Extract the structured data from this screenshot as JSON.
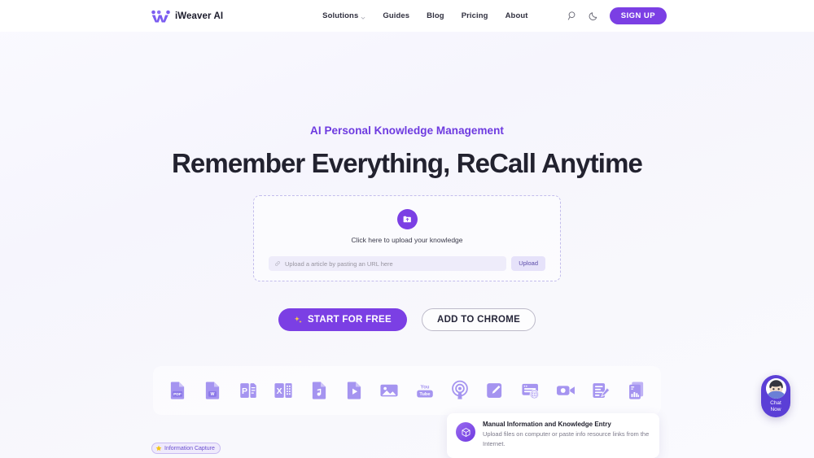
{
  "header": {
    "brand": {
      "name": "iWeaver AI",
      "logo_icon": "weaver-w-logo-icon"
    },
    "nav": [
      {
        "label": "Solutions",
        "has_dropdown": true
      },
      {
        "label": "Guides",
        "has_dropdown": false
      },
      {
        "label": "Blog",
        "has_dropdown": false
      },
      {
        "label": "Pricing",
        "has_dropdown": false
      },
      {
        "label": "About",
        "has_dropdown": false
      }
    ],
    "actions": {
      "search_icon": "search-icon",
      "theme_icon": "moon-icon",
      "signup_label": "SIGN UP"
    }
  },
  "hero": {
    "eyebrow": "AI Personal Knowledge Management",
    "headline": "Remember Everything, ReCall Anytime"
  },
  "upload": {
    "icon": "upload-folder-icon",
    "prompt": "Click here to upload your knowledge",
    "url_placeholder": "Upload a article by pasting an URL here",
    "url_value": "",
    "link_icon": "link-icon",
    "button_label": "Upload"
  },
  "cta": {
    "primary_label": "START FOR FREE",
    "primary_icon": "sparkle-icon",
    "secondary_label": "ADD TO CHROME"
  },
  "file_types": [
    {
      "label": "PDF",
      "icon": "pdf-file-icon"
    },
    {
      "label": "W",
      "icon": "word-file-icon"
    },
    {
      "label": "P",
      "icon": "powerpoint-file-icon"
    },
    {
      "label": "X",
      "icon": "excel-file-icon"
    },
    {
      "label": "Audio",
      "icon": "audio-file-icon"
    },
    {
      "label": "Video",
      "icon": "video-file-icon"
    },
    {
      "label": "Image",
      "icon": "image-file-icon"
    },
    {
      "label": "YouTube",
      "icon": "youtube-icon"
    },
    {
      "label": "Podcast",
      "icon": "podcast-icon"
    },
    {
      "label": "Note",
      "icon": "note-edit-icon"
    },
    {
      "label": "Webpage",
      "icon": "webpage-globe-icon"
    },
    {
      "label": "Recording",
      "icon": "video-camera-icon"
    },
    {
      "label": "Text Edit",
      "icon": "document-edit-icon"
    },
    {
      "label": "Report",
      "icon": "report-chart-icon"
    }
  ],
  "info_card": {
    "icon": "cube-icon",
    "title": "Manual Information and Knowledge Entry",
    "description": "Upload files on computer or paste info resource links from the Internet."
  },
  "badge": {
    "icon": "star-icon",
    "label": "Information Capture"
  },
  "chat": {
    "avatar_icon": "chat-avatar-icon",
    "line1": "Chat",
    "line2": "Now"
  },
  "colors": {
    "brand_purple": "#7b3fe4",
    "eyebrow_purple": "#6d3ae0",
    "headline_dark": "#22222f",
    "icon_lavender": "#a594f0",
    "chat_purple": "#5b3fd6",
    "star_yellow": "#f5c518"
  }
}
